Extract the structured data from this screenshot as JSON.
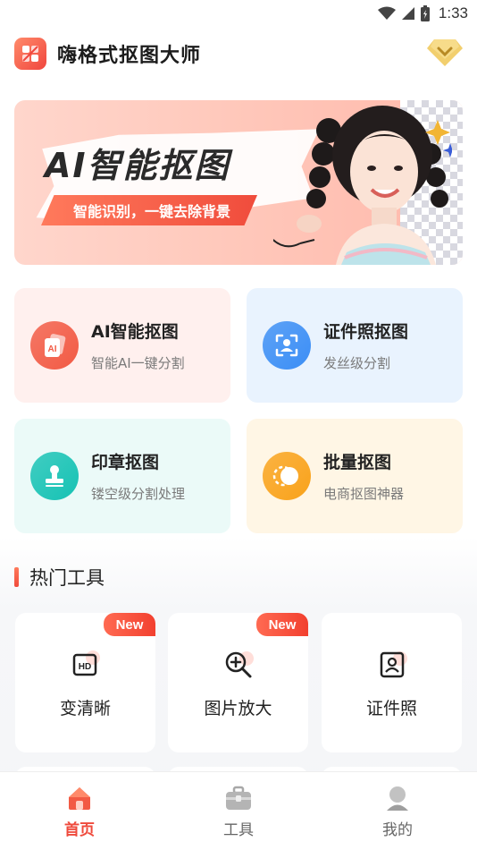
{
  "status_bar": {
    "time": "1:33"
  },
  "header": {
    "title": "嗨格式抠图大师"
  },
  "banner": {
    "title": "AI智能抠图",
    "subtitle": "智能识别，一键去除背景"
  },
  "features": [
    {
      "title": "AI智能抠图",
      "subtitle": "智能AI一键分割",
      "icon": "ai-cutout-icon",
      "bg": "#fff0ee",
      "color": "#f25a44"
    },
    {
      "title": "证件照抠图",
      "subtitle": "发丝级分割",
      "icon": "id-photo-icon",
      "bg": "#e9f3fe",
      "color": "#3b8ef5"
    },
    {
      "title": "印章抠图",
      "subtitle": "镂空级分割处理",
      "icon": "stamp-icon",
      "bg": "#ebfaf8",
      "color": "#16c2b4"
    },
    {
      "title": "批量抠图",
      "subtitle": "电商抠图神器",
      "icon": "batch-icon",
      "bg": "#fff6e5",
      "color": "#f9a21a"
    }
  ],
  "section": {
    "title": "热门工具"
  },
  "tools": [
    {
      "label": "变清晰",
      "badge": "New",
      "icon": "hd-icon"
    },
    {
      "label": "图片放大",
      "badge": "New",
      "icon": "zoom-in-icon"
    },
    {
      "label": "证件照",
      "badge": "",
      "icon": "id-card-icon"
    }
  ],
  "nav": [
    {
      "label": "首页",
      "icon": "home-icon",
      "active": true
    },
    {
      "label": "工具",
      "icon": "toolbox-icon",
      "active": false
    },
    {
      "label": "我的",
      "icon": "profile-icon",
      "active": false
    }
  ],
  "colors": {
    "accent": "#ef4a3c"
  }
}
